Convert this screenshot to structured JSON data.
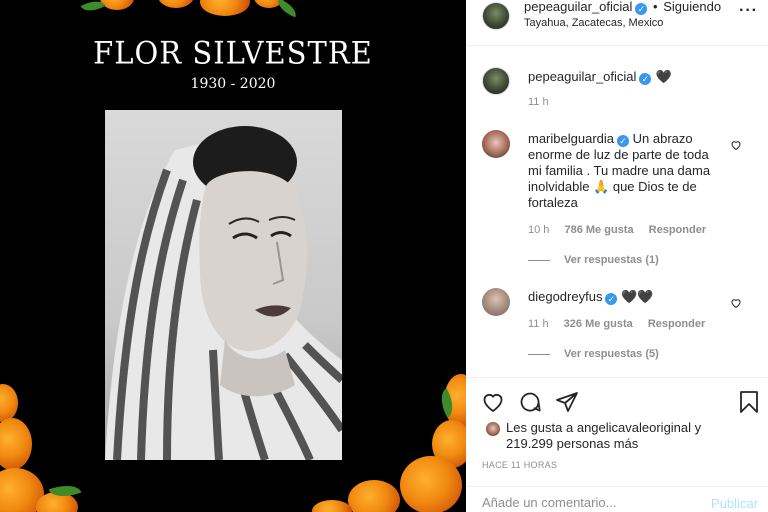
{
  "post": {
    "memorial_name": "FLOR SILVESTRE",
    "memorial_years": "1930 - 2020"
  },
  "header": {
    "username": "pepeaguilar_oficial",
    "separator": "•",
    "follow_status": "Siguiendo",
    "location": "Tayahua, Zacatecas, Mexico",
    "more_icon": "more-horizontal-icon"
  },
  "caption": {
    "username": "pepeaguilar_oficial",
    "text": "🖤",
    "time": "11 h"
  },
  "comments": [
    {
      "username": "maribelguardia",
      "verified": true,
      "lines": [
        "Un abrazo",
        "enorme de luz de parte de toda",
        "mi familia . Tu madre una dama",
        "inolvidable 🙏 que Dios te de",
        "fortaleza"
      ],
      "time": "10 h",
      "likes": "786 Me gusta",
      "reply_label": "Responder",
      "view_replies": "Ver respuestas (1)"
    },
    {
      "username": "diegodreyfus",
      "verified": true,
      "text": "🖤🖤",
      "time": "11 h",
      "likes": "326 Me gusta",
      "reply_label": "Responder",
      "view_replies": "Ver respuestas (5)"
    }
  ],
  "actions": {
    "like_icon": "heart-icon",
    "comment_icon": "comment-icon",
    "share_icon": "share-icon",
    "save_icon": "bookmark-icon"
  },
  "likes": {
    "prefix": "Les gusta a",
    "user": "angelicavaleoriginal",
    "connector": "y",
    "count": "219.299 personas más"
  },
  "timestamp": "HACE 11 HORAS",
  "add_comment": {
    "placeholder": "Añade un comentario...",
    "publish_label": "Publicar"
  },
  "colors": {
    "verified": "#3897f0",
    "publish_disabled": "#b2dffc",
    "muted": "#8e8e8e",
    "marigold": "#f08a10"
  }
}
